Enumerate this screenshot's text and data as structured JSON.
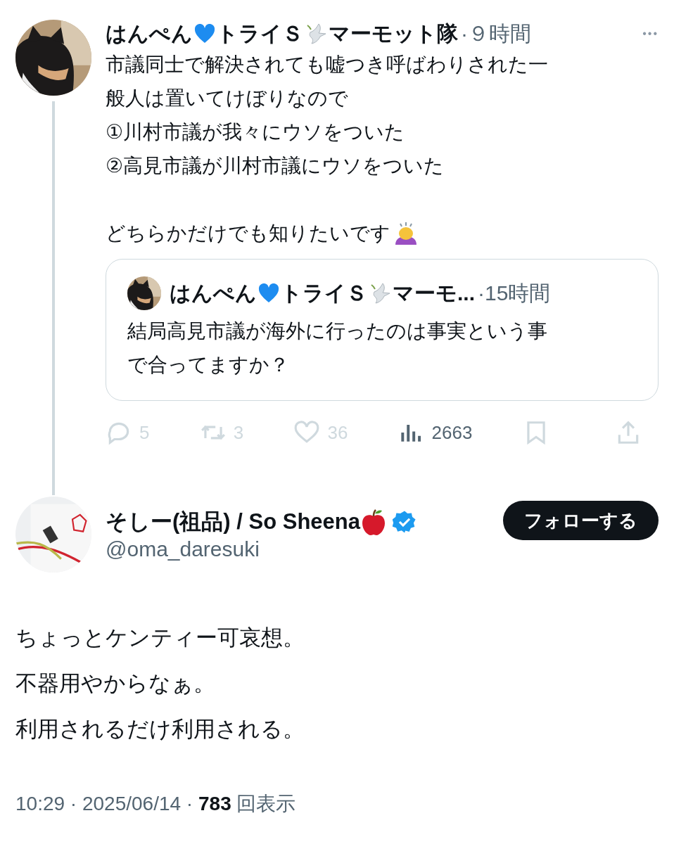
{
  "parent_tweet": {
    "author": [
      {
        "kind": "text",
        "text": "はんぺん"
      },
      {
        "kind": "heart"
      },
      {
        "kind": "text",
        "text": "トライＳ"
      },
      {
        "kind": "dove"
      },
      {
        "kind": "text",
        "text": "マーモット隊"
      }
    ],
    "time": "·９時間",
    "more": "•••",
    "paragraphs": [
      {
        "lines": [
          "市議同士で解決されても嘘つき呼ばわりされた一",
          "般人は置いてけぼりなので",
          "①川村市議が我々にウソをついた",
          "②高見市議が川村市議にウソをついた"
        ]
      },
      {
        "lines": [
          "どちらかだけでも知りたいです"
        ],
        "end": [
          {
            "kind": "bowing"
          }
        ]
      }
    ],
    "quote": {
      "author": [
        {
          "kind": "text",
          "text": "はんぺん"
        },
        {
          "kind": "heart"
        },
        {
          "kind": "text",
          "text": "トライＳ"
        },
        {
          "kind": "dove"
        },
        {
          "kind": "text",
          "text": "マーモ..."
        }
      ],
      "time": "·15時間",
      "body": [
        "結局高見市議が海外に行ったのは事実という事",
        "で合ってますか？"
      ]
    },
    "actions": [
      {
        "kind": "reply",
        "count": "5",
        "dimmed": true
      },
      {
        "kind": "repost",
        "count": "3",
        "dimmed": true
      },
      {
        "kind": "like",
        "count": "36",
        "dimmed": true
      },
      {
        "kind": "views",
        "count": "2663",
        "dimmed": false
      },
      {
        "kind": "bookmark",
        "dimmed": true
      },
      {
        "kind": "share",
        "dimmed": true
      }
    ]
  },
  "tweet": {
    "author": [
      {
        "kind": "text",
        "text": "そしー(祖品) / So Sheena"
      },
      {
        "kind": "apple"
      }
    ],
    "verified": true,
    "handle": "@oma_daresuki",
    "follow_button": "フォローする",
    "body": [
      "ちょっとケンティー可哀想。",
      "不器用やからなぁ。",
      "利用されるだけ利用される。"
    ],
    "footer": {
      "time": "10:29 · 2025/06/14 · ",
      "views": "783",
      "views_label": "回表示"
    }
  }
}
